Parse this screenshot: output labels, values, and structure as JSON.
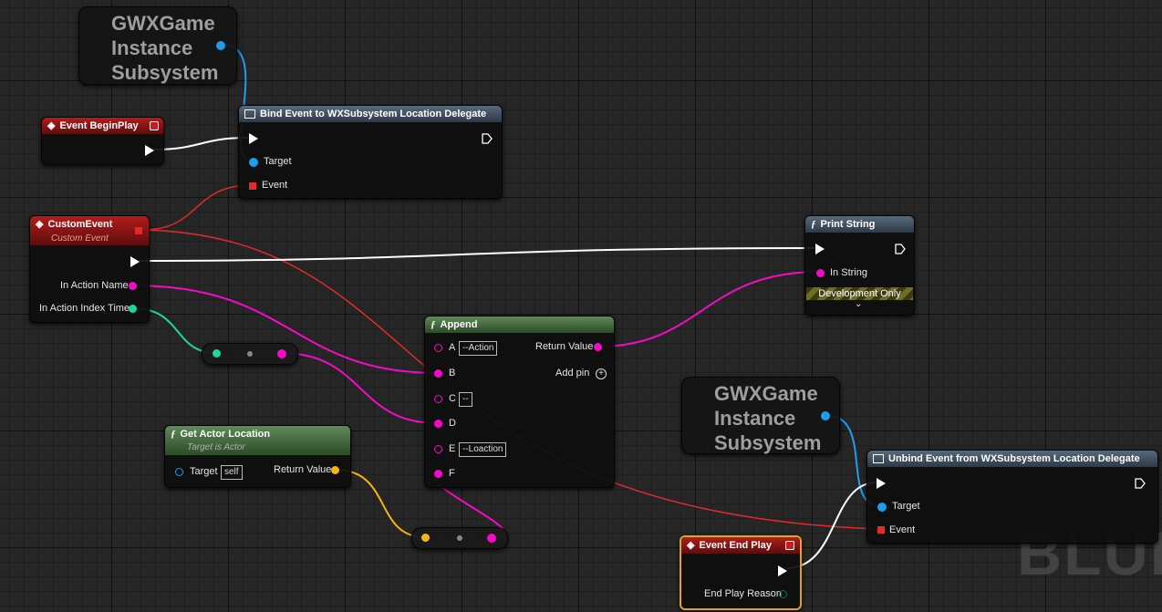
{
  "colors": {
    "exec": "#ffffff",
    "object": "#1e9cf0",
    "delegate": "#e22a2a",
    "string": "#f50ac8",
    "float": "#1ed79a",
    "vector": "#f5b414"
  },
  "subsystem_top": {
    "title": "GWXGame Instance Subsystem"
  },
  "subsystem_bottom": {
    "title": "GWXGame Instance Subsystem"
  },
  "begin_play": {
    "title": "Event BeginPlay"
  },
  "bind_event": {
    "title": "Bind Event to WXSubsystem Location Delegate",
    "target_label": "Target",
    "event_label": "Event"
  },
  "custom_event": {
    "title": "CustomEvent",
    "subtitle": "Custom Event",
    "pin_action_name": "In Action Name",
    "pin_action_index_time": "In Action Index Time"
  },
  "print_string": {
    "title": "Print String",
    "in_string_label": "In String",
    "dev_only": "Development Only",
    "expand_icon": "chevron-down-icon"
  },
  "append": {
    "title": "Append",
    "pins": [
      {
        "label": "A",
        "value": "--Action"
      },
      {
        "label": "B",
        "value": ""
      },
      {
        "label": "C",
        "value": "--"
      },
      {
        "label": "D",
        "value": ""
      },
      {
        "label": "E",
        "value": "--Loaction"
      },
      {
        "label": "F",
        "value": ""
      }
    ],
    "return_label": "Return Value",
    "add_pin_label": "Add pin"
  },
  "get_actor_location": {
    "title": "Get Actor Location",
    "subtitle": "Target is Actor",
    "target_label": "Target",
    "target_value": "self",
    "return_label": "Return Value"
  },
  "unbind_event": {
    "title": "Unbind Event from WXSubsystem Location Delegate",
    "target_label": "Target",
    "event_label": "Event"
  },
  "end_play": {
    "title": "Event End Play",
    "pin_reason": "End Play Reason"
  },
  "watermark": "BLUE"
}
